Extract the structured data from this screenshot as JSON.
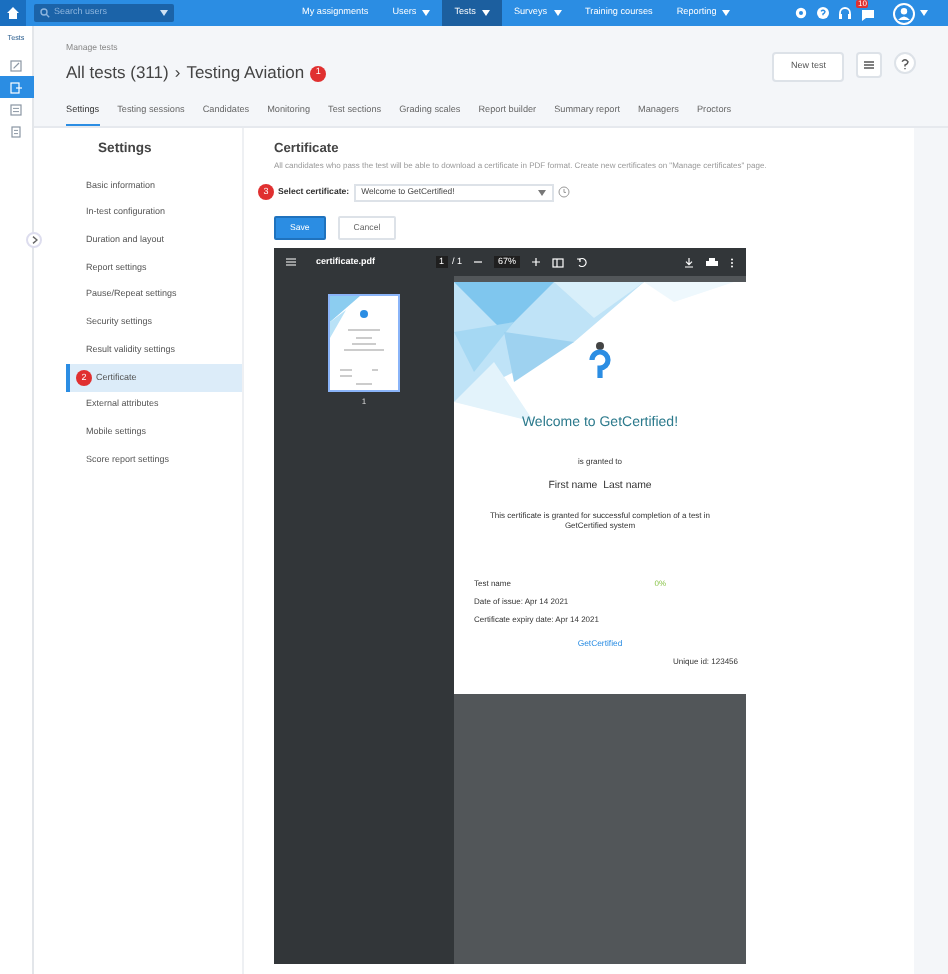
{
  "nav": {
    "search_placeholder": "Search users",
    "notification_count": "10",
    "items": [
      {
        "label": "My assignments",
        "selected": false,
        "dropdown": false
      },
      {
        "label": "Users",
        "selected": false,
        "dropdown": true
      },
      {
        "label": "Tests",
        "selected": true,
        "dropdown": true
      },
      {
        "label": "Surveys",
        "selected": false,
        "dropdown": true
      },
      {
        "label": "Training courses",
        "selected": false,
        "dropdown": false
      },
      {
        "label": "Reporting",
        "selected": false,
        "dropdown": true
      }
    ]
  },
  "rail": {
    "label": "Tests",
    "items": [
      {
        "kind": "edit",
        "selected": false
      },
      {
        "kind": "exit",
        "selected": true
      },
      {
        "kind": "list",
        "selected": false
      },
      {
        "kind": "doc",
        "selected": false
      }
    ]
  },
  "header": {
    "breadcrumb": "Manage tests",
    "title": "All tests (311)",
    "separator": "›",
    "subtitle": "Testing Aviation",
    "badge": "1",
    "new_button": "New test"
  },
  "tabs": [
    {
      "label": "Settings",
      "selected": true
    },
    {
      "label": "Testing sessions",
      "selected": false
    },
    {
      "label": "Candidates",
      "selected": false
    },
    {
      "label": "Monitoring",
      "selected": false
    },
    {
      "label": "Test sections",
      "selected": false
    },
    {
      "label": "Grading scales",
      "selected": false
    },
    {
      "label": "Report builder",
      "selected": false
    },
    {
      "label": "Summary report",
      "selected": false
    },
    {
      "label": "Managers",
      "selected": false
    },
    {
      "label": "Proctors",
      "selected": false
    }
  ],
  "settings": {
    "title": "Settings",
    "items": [
      {
        "label": "Basic information",
        "selected": false
      },
      {
        "label": "In-test configuration",
        "selected": false
      },
      {
        "label": "Duration and layout",
        "selected": false
      },
      {
        "label": "Report settings",
        "selected": false
      },
      {
        "label": "Pause/Repeat settings",
        "selected": false
      },
      {
        "label": "Security settings",
        "selected": false
      },
      {
        "label": "Result validity settings",
        "selected": false
      },
      {
        "label": "Certificate",
        "selected": true,
        "badge": "2"
      },
      {
        "label": "External attributes",
        "selected": false
      },
      {
        "label": "Mobile settings",
        "selected": false
      },
      {
        "label": "Score report settings",
        "selected": false
      }
    ]
  },
  "certificate": {
    "title": "Certificate",
    "description": "All candidates who pass the test will be able to download a certificate in PDF format. Create new certificates on \"Manage certificates\" page.",
    "select_badge": "3",
    "select_label": "Select certificate:",
    "select_value": "Welcome to GetCertified!",
    "save": "Save",
    "cancel": "Cancel"
  },
  "pdf": {
    "filename": "certificate.pdf",
    "page": "1",
    "pages": "/ 1",
    "zoom": "67%",
    "thumb_label": "1",
    "doc": {
      "heading": "Welcome to GetCertified!",
      "granted": "is granted to",
      "name": "First name  Last name",
      "statement": "This certificate is granted for successful completion of a test in GetCertified system",
      "test_name": "Test name",
      "score": "0%",
      "issue_date": "Date of issue: Apr 14 2021",
      "expiry_date": "Certificate expiry date: Apr 14 2021",
      "brand": "GetCertified",
      "unique_id": "Unique id: 123456"
    }
  }
}
